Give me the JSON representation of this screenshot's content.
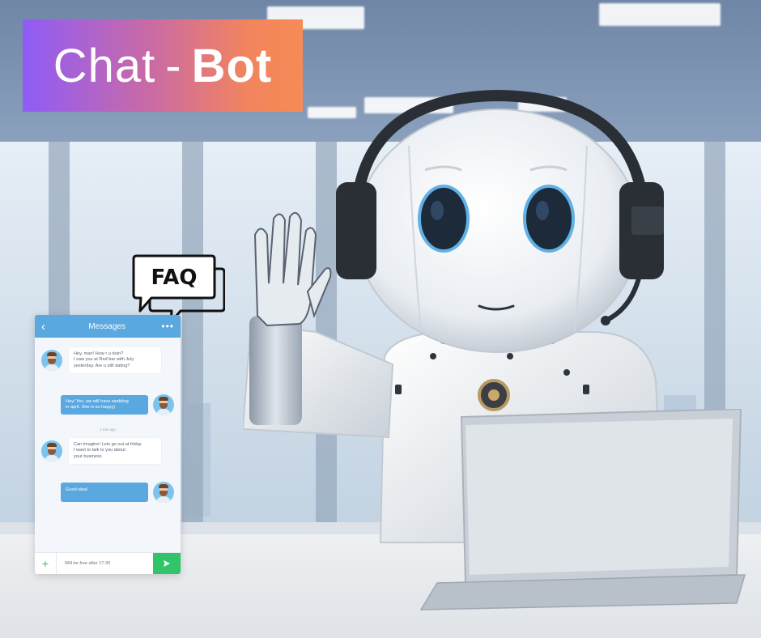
{
  "title": {
    "word1": "Chat",
    "separator": "-",
    "word2": "Bot",
    "gradient": [
      "#8f5cf7",
      "#f68b55"
    ]
  },
  "faq": {
    "label": "FAQ"
  },
  "chat": {
    "header_title": "Messages",
    "back_icon": "chevron-left-icon",
    "menu_icon": "more-dots-icon",
    "accent_color": "#5aa8e0",
    "send_color": "#31c46b",
    "messages": [
      {
        "side": "in",
        "lines": [
          "Hey, man! How r u doin?",
          "I saw you at Red bar with July",
          "yesterday. Are u still dating?"
        ]
      },
      {
        "side": "out",
        "lines": [
          "Hey! Yes, we will have wedding",
          "in april. She is so happy)"
        ]
      },
      {
        "side": "in",
        "lines": [
          "Can imagine! Lets go out at friday",
          "I want to talk to you about",
          "your business"
        ]
      },
      {
        "side": "out",
        "lines": [
          "Good idea!"
        ]
      }
    ],
    "timestamp": "1 min ago",
    "input_text": "Will be free after 17:30",
    "add_icon": "plus-icon",
    "send_icon": "send-icon"
  },
  "scene": {
    "robot_icon": "robot-with-headset",
    "laptop_icon": "laptop-icon"
  }
}
